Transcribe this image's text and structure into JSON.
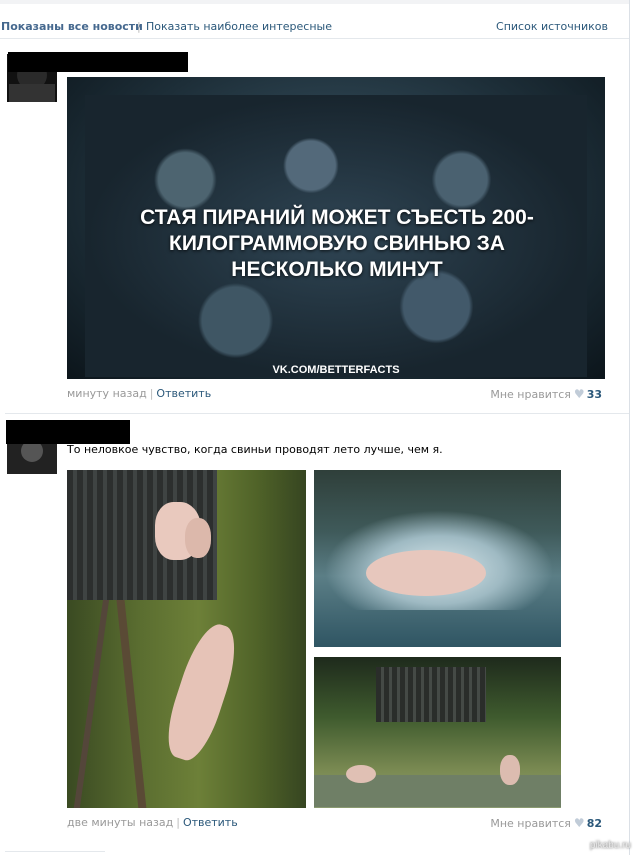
{
  "filter": {
    "active_label": "Показаны все новости",
    "separator": "|",
    "alt_label": "Показать наиболее интересные",
    "sources_label": "Список источников"
  },
  "posts": [
    {
      "image_caption": "СТАЯ ПИРАНИЙ МОЖЕТ СЪЕСТЬ 200-КИЛОГРАММОВУЮ СВИНЬЮ ЗА НЕСКОЛЬКО МИНУТ",
      "image_watermark": "VK.COM/BETTERFACTS",
      "time": "минуту назад",
      "separator": "|",
      "reply_label": "Ответить",
      "like_label": "Мне нравится",
      "like_icon": "heart-icon",
      "like_count": "33"
    },
    {
      "text": "То неловкое чувство, когда свиньи проводят лето лучше, чем я.",
      "time": "две минуты назад",
      "separator": "|",
      "reply_label": "Ответить",
      "like_label": "Мне нравится",
      "like_icon": "heart-icon",
      "like_count": "82"
    }
  ],
  "watermark": "pikabu.ru",
  "colors": {
    "link": "#2b587a",
    "active": "#45688e",
    "muted": "#999999",
    "divider": "#e4e8ec"
  }
}
